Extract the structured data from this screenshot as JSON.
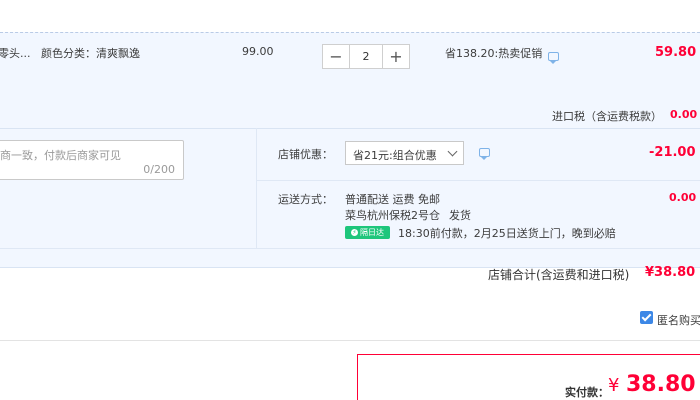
{
  "item": {
    "title_fragment": "零头...",
    "sku": "颜色分类：清爽飘逸",
    "unit_price": "99.00",
    "quantity": "2",
    "promo": "省138.20:热卖促销",
    "subtotal": "59.80",
    "import_tax_label": "进口税（含运费税款）",
    "import_tax_value": "0.00"
  },
  "message": {
    "placeholder": "商一致，付款后商家可见",
    "counter": "0/200"
  },
  "shop_discount": {
    "label": "店铺优惠：",
    "selected": "省21元:组合优惠",
    "value": "-21.00"
  },
  "shipping": {
    "label": "运送方式：",
    "method": "普通配送 运费 免邮",
    "warehouse": "菜鸟杭州保税2号仓",
    "dispatch": "发货",
    "badge": "隔日达",
    "delivery_note": "18:30前付款，2月25日送货上门，晚到必赔",
    "value": "0.00"
  },
  "shop_total": {
    "label": "店铺合计(含运费和进口税)",
    "value": "¥38.80"
  },
  "anonymous": {
    "label": "匿名购买"
  },
  "payment": {
    "label": "实付款：",
    "currency": "¥",
    "amount": "38.80"
  },
  "colors": {
    "accent_red": "#ff0036",
    "panel_bg": "#f2f7ff",
    "checkbox_blue": "#3c87e6",
    "badge_green": "#1ec67c"
  }
}
